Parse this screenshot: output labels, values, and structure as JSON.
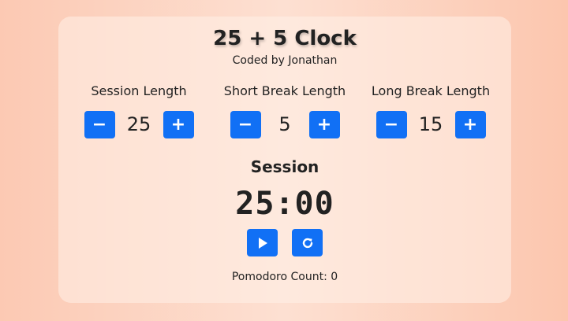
{
  "app": {
    "title": "25 + 5 Clock",
    "subtitle": "Coded by Jonathan"
  },
  "settings": [
    {
      "label": "Session Length",
      "value": "25",
      "decrement": "−",
      "increment": "+"
    },
    {
      "label": "Short Break Length",
      "value": "5",
      "decrement": "−",
      "increment": "+"
    },
    {
      "label": "Long Break Length",
      "value": "15",
      "decrement": "−",
      "increment": "+"
    }
  ],
  "timer": {
    "label": "Session",
    "display": "25:00",
    "play_icon": "play-icon",
    "reset_icon": "refresh-icon"
  },
  "pomodoro": {
    "text": "Pomodoro Count: 0"
  },
  "colors": {
    "button": "#1170f5",
    "text": "#222222",
    "background_start": "#fcc9b3",
    "background_end": "#fcc6ae"
  }
}
